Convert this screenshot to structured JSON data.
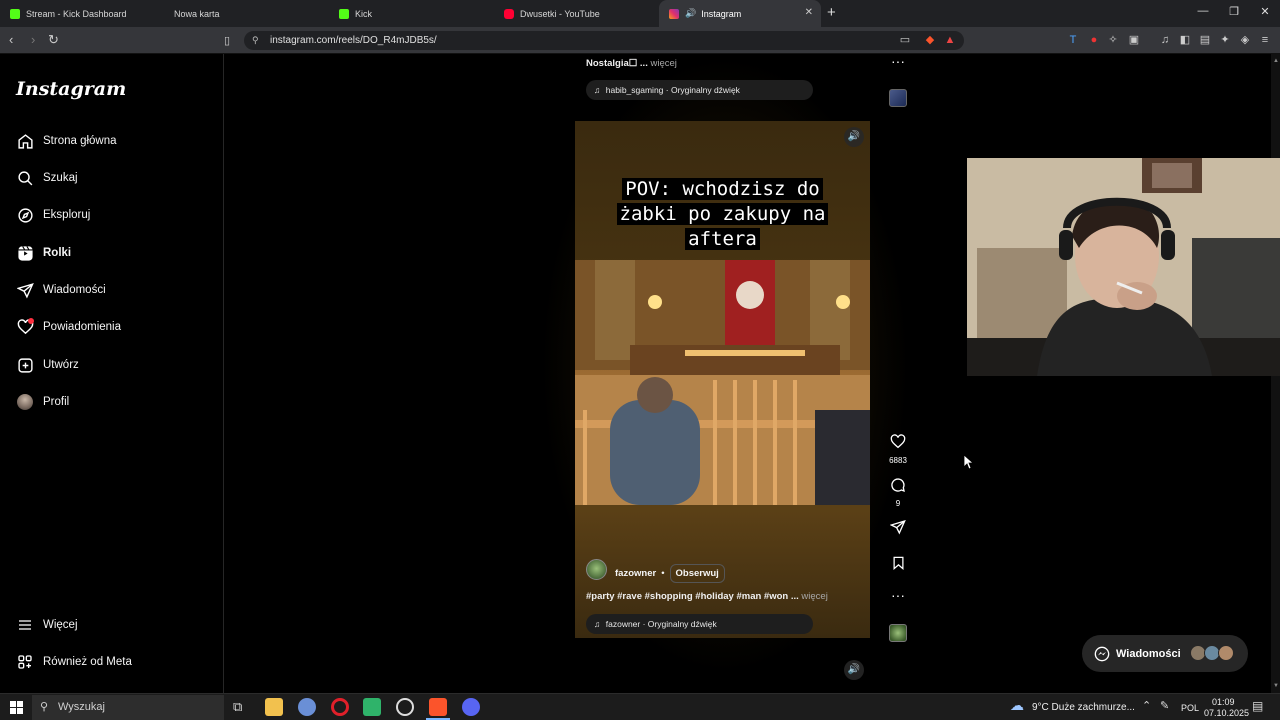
{
  "browser": {
    "tabs": [
      {
        "title": "Stream - Kick Dashboard",
        "color": "#53fc18"
      },
      {
        "title": "Nowa karta",
        "color": ""
      },
      {
        "title": "Kick",
        "color": "#53fc18"
      },
      {
        "title": "Dwusetki - YouTube",
        "color": "#ff0033"
      },
      {
        "title": "Instagram",
        "color": "#e1306c",
        "active": true
      }
    ],
    "url": "instagram.com/reels/DO_R4mJDB5s/"
  },
  "sidebar": {
    "logo": "Instagram",
    "items": [
      {
        "label": "Strona główna",
        "icon": "home-icon"
      },
      {
        "label": "Szukaj",
        "icon": "search-icon"
      },
      {
        "label": "Eksploruj",
        "icon": "compass-icon"
      },
      {
        "label": "Rolki",
        "icon": "reels-icon"
      },
      {
        "label": "Wiadomości",
        "icon": "send-icon"
      },
      {
        "label": "Powiadomienia",
        "icon": "heart-icon"
      },
      {
        "label": "Utwórz",
        "icon": "plus-icon"
      },
      {
        "label": "Profil",
        "icon": "avatar"
      }
    ],
    "more": "Więcej",
    "meta": "Również od Meta"
  },
  "prev_reel": {
    "caption": "Nostalgia☐ ...",
    "more": "więcej",
    "audio": "habib_sgaming · Oryginalny dźwięk"
  },
  "reel": {
    "overlay_text": [
      "POV: wchodzisz do",
      "żabki po zakupy na",
      "aftera"
    ],
    "author": "fazowner",
    "dot": "•",
    "follow": "Obserwuj",
    "caption": "#party #rave #shopping #holiday #man #won ...",
    "more": "więcej",
    "audio": "fazowner · Oryginalny dźwięk",
    "likes": "6883",
    "comments": "9"
  },
  "messages": {
    "label": "Wiadomości"
  },
  "taskbar": {
    "search": "Wyszukaj",
    "weather": "9°C  Duże zachmurze...",
    "lang": "POL",
    "time": "01:09",
    "date": "07.10.2025"
  }
}
